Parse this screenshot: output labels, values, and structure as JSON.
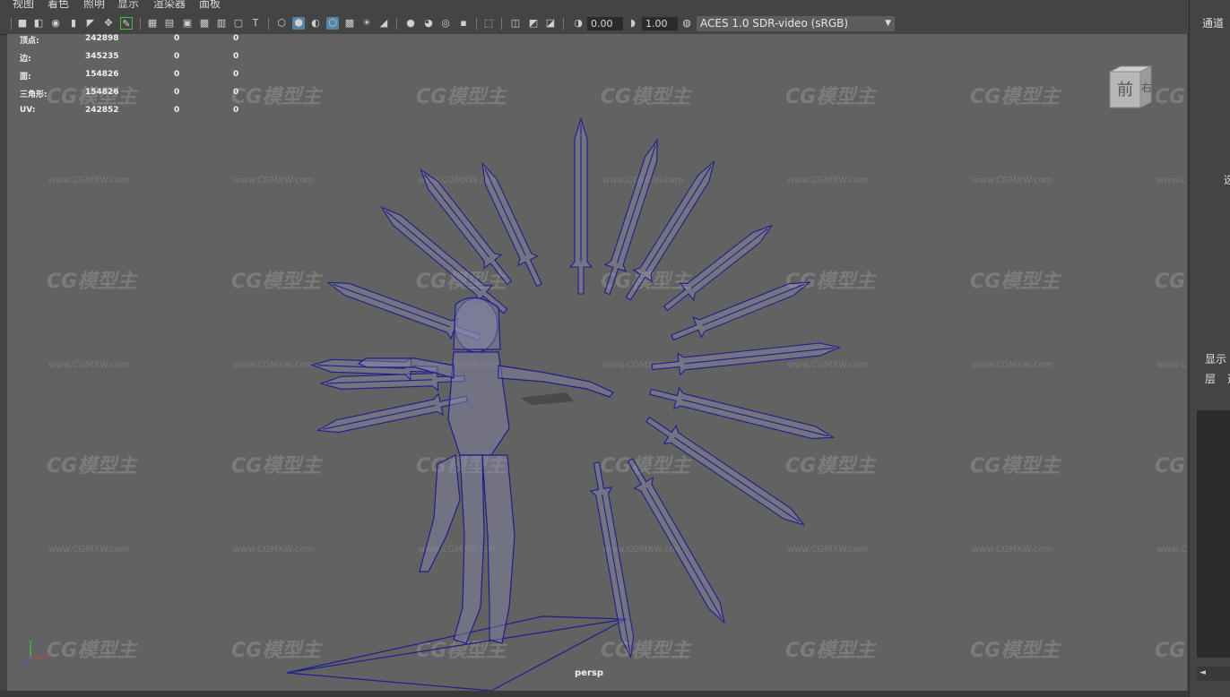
{
  "menu": [
    "视图",
    "着色",
    "照明",
    "显示",
    "渲染器",
    "面板"
  ],
  "toolbar": {
    "exposure": "0.00",
    "gamma": "1.00",
    "color_space": "ACES 1.0 SDR-video (sRGB)"
  },
  "hud": {
    "rows": [
      {
        "label": "顶点:",
        "v1": "242898",
        "v2": "0",
        "v3": "0"
      },
      {
        "label": "边:",
        "v1": "345235",
        "v2": "0",
        "v3": "0"
      },
      {
        "label": "面:",
        "v1": "154826",
        "v2": "0",
        "v3": "0"
      },
      {
        "label": "三角形:",
        "v1": "154826",
        "v2": "0",
        "v3": "0"
      },
      {
        "label": "UV:",
        "v1": "242852",
        "v2": "0",
        "v3": "0"
      }
    ]
  },
  "viewcube": {
    "front": "前",
    "right": "右"
  },
  "camera_label": "persp",
  "axis": {
    "x": "x",
    "y": "y",
    "z": "z"
  },
  "watermark": {
    "logo": "CG模型主",
    "url": "www.CGMXW.com"
  },
  "right_panel": {
    "channels_tab": "通道",
    "side_text": "选",
    "display_tab": "显示",
    "layer_label": "层",
    "layer_extra": "选",
    "scroll_left": "◄"
  },
  "colors": {
    "viewport": "#626262",
    "wire": "#1e1e8c",
    "active_icon": "#5285a6"
  }
}
